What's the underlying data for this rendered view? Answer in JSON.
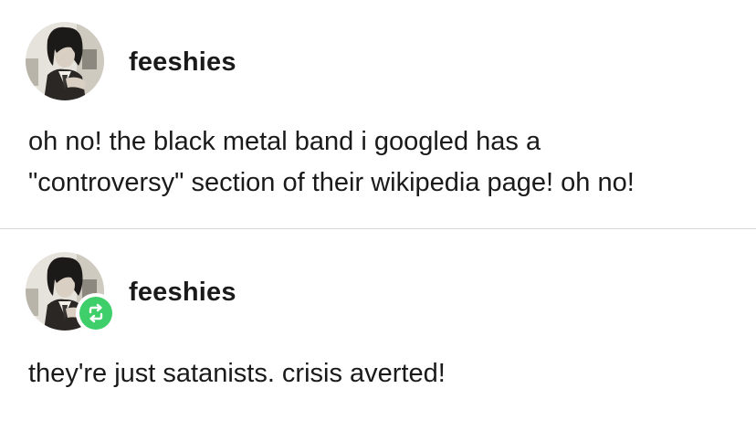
{
  "posts": [
    {
      "username": "feeshies",
      "avatar": "avatar-photo",
      "body_lines": [
        "oh no! the black metal band i googled has a",
        "\"controversy\" section of their wikipedia page! oh no!"
      ]
    },
    {
      "username": "feeshies",
      "avatar": "avatar-photo",
      "badge_icon": "reblog-icon",
      "badge_color": "#3fcf6a",
      "body_lines": [
        "they're just satanists. crisis averted!"
      ]
    }
  ]
}
